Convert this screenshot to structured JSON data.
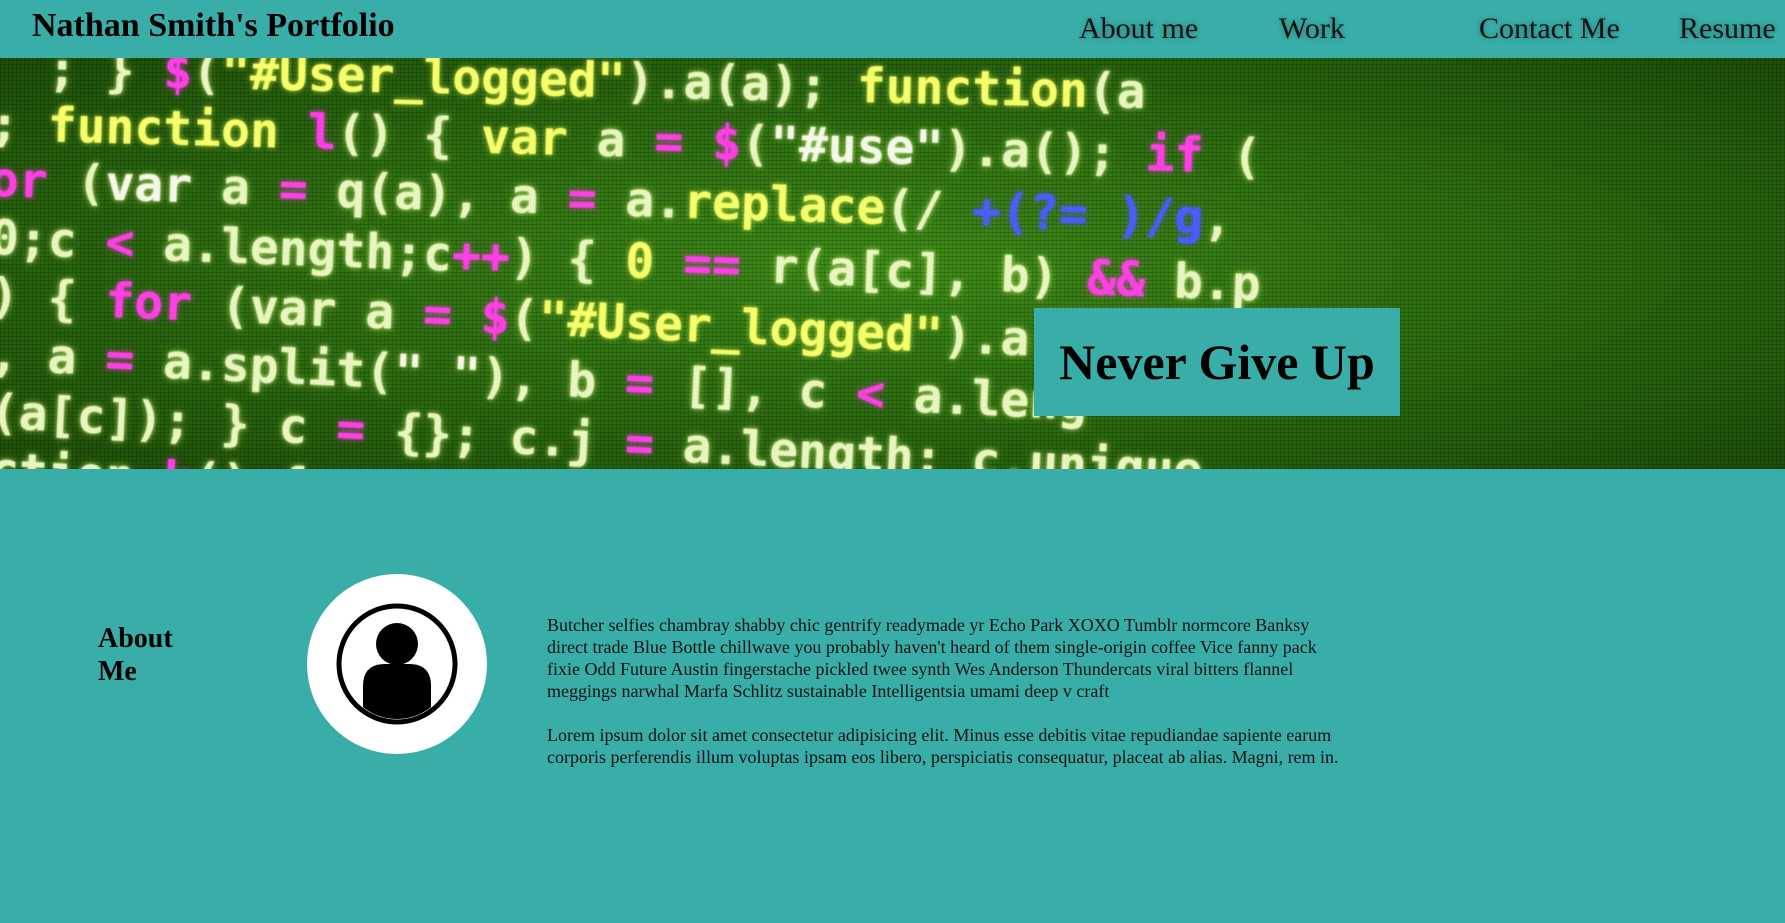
{
  "header": {
    "brand": "Nathan Smith's Portfolio",
    "nav": [
      {
        "label": "About me"
      },
      {
        "label": "Work"
      },
      {
        "label": "Contact Me"
      },
      {
        "label": "Resume"
      }
    ]
  },
  "hero": {
    "tagline": "Never Give Up"
  },
  "about": {
    "heading": "About Me",
    "paragraphs": [
      "Butcher selfies chambray shabby chic gentrify readymade yr Echo Park XOXO Tumblr normcore Banksy direct trade Blue Bottle chillwave you probably haven't heard of them single-origin coffee Vice fanny pack fixie Odd Future Austin fingerstache pickled twee synth Wes Anderson Thundercats viral bitters flannel meggings narwhal Marfa Schlitz sustainable Intelligentsia umami deep v craft",
      "Lorem ipsum dolor sit amet consectetur adipisicing elit. Minus esse debitis vitae repudiandae sapiente earum corporis perferendis illum voluptas ipsam eos libero, perspiciatis consequatur, placeat ab alias. Magni, rem in."
    ]
  },
  "colors": {
    "background": "#39aea9",
    "avatar_bg": "#ffffff"
  },
  "icons": {
    "avatar": "person-silhouette-icon"
  }
}
